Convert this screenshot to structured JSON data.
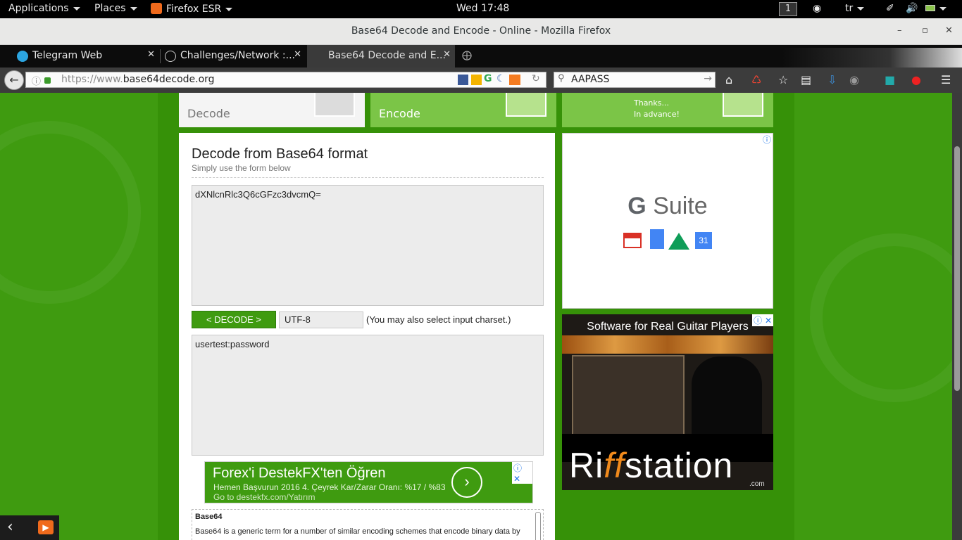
{
  "topbar": {
    "applications": "Applications",
    "places": "Places",
    "firefox": "Firefox ESR",
    "clock": "Wed 17:48",
    "workspace": "1",
    "keyboard": "tr"
  },
  "window": {
    "title": "Base64 Decode and Encode - Online - Mozilla Firefox"
  },
  "tabs": [
    {
      "label": "Telegram Web"
    },
    {
      "label": "Challenges/Network :..."
    },
    {
      "label": "Base64 Decode and E...",
      "active": true
    }
  ],
  "navbar": {
    "url_prefix": "https://www.",
    "url_domain": "base64decode.org",
    "search_value": "AAPASS"
  },
  "site": {
    "nav": {
      "decode": "Decode",
      "encode": "Encode",
      "thanks_line1": "Thanks...",
      "thanks_line2": "In advance!"
    },
    "heading": "Decode from Base64 format",
    "subheading": "Simply use the form below",
    "input_value": "dXNlcnRlc3Q6cGFzc3dvcmQ=",
    "decode_button": "< DECODE >",
    "charset": "UTF-8",
    "charset_hint": "(You may also select input charset.)",
    "output_value": "usertest:password",
    "info_title": "Base64",
    "info_text": "Base64 is a generic term for a number of similar encoding schemes that encode binary data by"
  },
  "ads": {
    "forex_title": "Forex'i DestekFX'ten Öğren",
    "forex_line1": "Hemen Başvurun 2016 4. Çeyrek Kar/Zarar Oranı: %17 / %83",
    "forex_line2": "Go to destekfx.com/Yatırım",
    "gsuite_g": "G",
    "gsuite_suite": " Suite",
    "gsuite_cal": "31",
    "riff_tagline": "Software for Real Guitar Players",
    "riff_brand_a": "Ri",
    "riff_brand_ff": "ff",
    "riff_brand_b": "station",
    "riff_com": ".com"
  },
  "colors": {
    "site_green": "#3f9b10",
    "tile_green": "#7bc547",
    "firefox_orange": "#f06a1c"
  }
}
